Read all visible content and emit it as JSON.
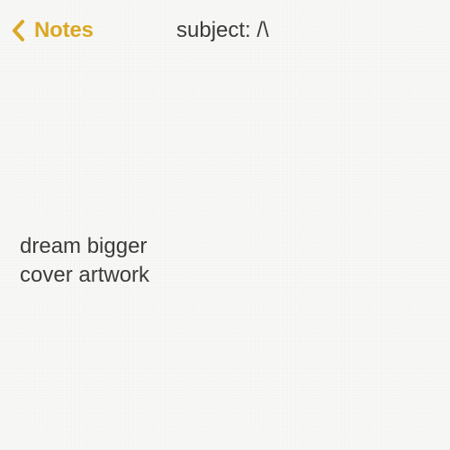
{
  "nav": {
    "back_label": "Notes",
    "back_icon": "chevron-left-icon",
    "title": "subject: /\\",
    "accent_color": "#dba825"
  },
  "note": {
    "lines": [
      "dream bigger",
      "cover artwork"
    ]
  }
}
